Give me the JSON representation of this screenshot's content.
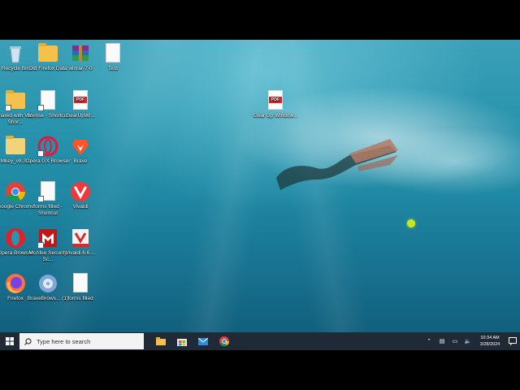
{
  "desktop": {
    "icons": [
      {
        "label": "Recycle Bin",
        "icon": "recycle-bin-icon"
      },
      {
        "label": "Old Firefox Data",
        "icon": "folder-icon"
      },
      {
        "label": "winrar-7-0",
        "icon": "winrar-icon"
      },
      {
        "label": "Test",
        "icon": "text-document-icon"
      },
      {
        "label": "Shared with VM - Shor...",
        "icon": "shortcut-folder-icon"
      },
      {
        "label": "license - Shortcut",
        "icon": "shortcut-document-icon"
      },
      {
        "label": "GearUpWi...",
        "icon": "pdf-icon"
      },
      {
        "label": "Gear Up Window...",
        "icon": "pdf-icon"
      },
      {
        "label": "Mkey_v8.3...",
        "icon": "file-icon"
      },
      {
        "label": "Opera GX Browser",
        "icon": "opera-gx-icon"
      },
      {
        "label": "Brave",
        "icon": "brave-icon"
      },
      {
        "label": "Google Chrome",
        "icon": "chrome-icon"
      },
      {
        "label": "forms filled - Shortcut",
        "icon": "shortcut-document-icon"
      },
      {
        "label": "Vivaldi",
        "icon": "vivaldi-icon"
      },
      {
        "label": "Opera Browser",
        "icon": "opera-icon"
      },
      {
        "label": "McAfee Security Sc...",
        "icon": "mcafee-icon"
      },
      {
        "label": "Vivaldi.6.6....",
        "icon": "vivaldi-installer-icon"
      },
      {
        "label": "Firefox",
        "icon": "firefox-icon"
      },
      {
        "label": "BraveBrows... (1)",
        "icon": "brave-installer-icon"
      },
      {
        "label": "forms filled",
        "icon": "text-document-icon"
      }
    ]
  },
  "taskbar": {
    "search_placeholder": "Type here to search",
    "pinned": [
      "file-explorer-icon",
      "microsoft-store-icon",
      "mail-icon",
      "chrome-icon"
    ],
    "time": "10:34 AM",
    "date": "3/28/2024"
  },
  "colors": {
    "taskbar": "#1f2a36",
    "water": "#1f88a3",
    "cursor": "#c8e820"
  }
}
